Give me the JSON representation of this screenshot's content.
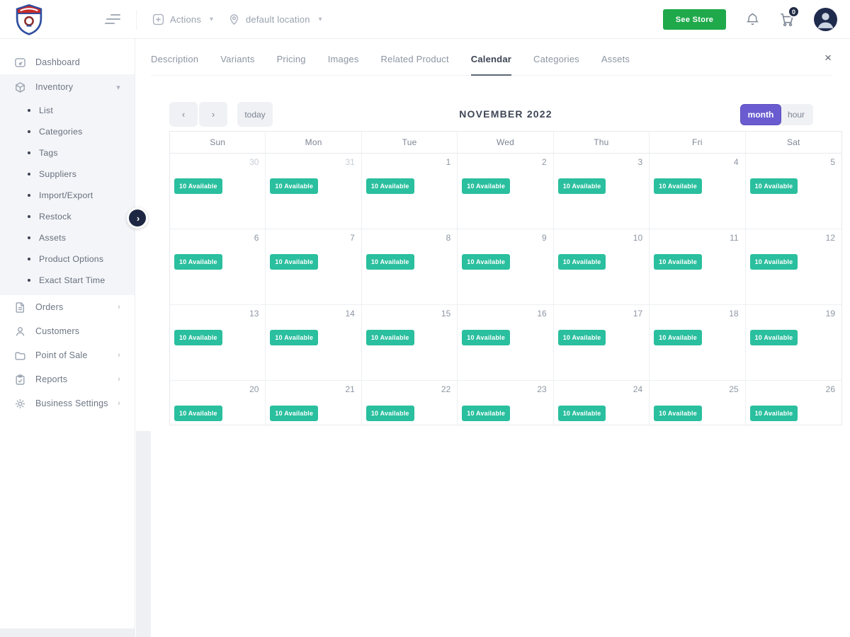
{
  "topbar": {
    "actions": "Actions",
    "location": "default location",
    "see_store": "See Store",
    "cart_count": "0"
  },
  "tabs": {
    "items": [
      "Description",
      "Variants",
      "Pricing",
      "Images",
      "Related Product",
      "Calendar",
      "Categories",
      "Assets"
    ],
    "active": "Calendar",
    "close": "×"
  },
  "sidebar": {
    "items": [
      {
        "label": "Dashboard"
      },
      {
        "label": "Inventory"
      },
      {
        "label": "Orders"
      },
      {
        "label": "Customers"
      },
      {
        "label": "Point of Sale"
      },
      {
        "label": "Reports"
      },
      {
        "label": "Business Settings"
      }
    ],
    "inventory_sub": [
      "List",
      "Categories",
      "Tags",
      "Suppliers",
      "Import/Export",
      "Restock",
      "Assets",
      "Product Options",
      "Exact Start Time"
    ]
  },
  "calendar": {
    "title": "NOVEMBER 2022",
    "prev": "‹",
    "next": "›",
    "today_label": "today",
    "view_month": "month",
    "view_hour": "hour",
    "active_view": "month",
    "day_headers": [
      "Sun",
      "Mon",
      "Tue",
      "Wed",
      "Thu",
      "Fri",
      "Sat"
    ],
    "badge_text": "10 Available",
    "weeks": [
      [
        {
          "date": "30",
          "muted": true
        },
        {
          "date": "31",
          "muted": true
        },
        {
          "date": "1"
        },
        {
          "date": "2"
        },
        {
          "date": "3"
        },
        {
          "date": "4"
        },
        {
          "date": "5"
        }
      ],
      [
        {
          "date": "6"
        },
        {
          "date": "7"
        },
        {
          "date": "8"
        },
        {
          "date": "9"
        },
        {
          "date": "10"
        },
        {
          "date": "11"
        },
        {
          "date": "12"
        }
      ],
      [
        {
          "date": "13"
        },
        {
          "date": "14"
        },
        {
          "date": "15"
        },
        {
          "date": "16"
        },
        {
          "date": "17"
        },
        {
          "date": "18"
        },
        {
          "date": "19"
        }
      ],
      [
        {
          "date": "20"
        },
        {
          "date": "21"
        },
        {
          "date": "22"
        },
        {
          "date": "23"
        },
        {
          "date": "24"
        },
        {
          "date": "25"
        },
        {
          "date": "26"
        }
      ]
    ]
  },
  "colors": {
    "badge_teal": "#2abf9e",
    "accent_purple": "#6a5cd0",
    "accent_green": "#1fa94b",
    "navy": "#1f2b4d"
  }
}
